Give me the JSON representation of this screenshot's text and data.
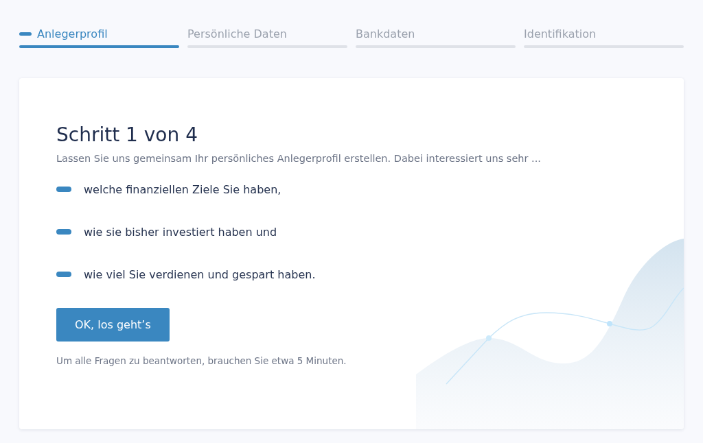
{
  "steps": [
    {
      "label": "Anlegerprofil",
      "selected": true
    },
    {
      "label": "Persönliche Daten",
      "selected": false
    },
    {
      "label": "Bankdaten",
      "selected": false
    },
    {
      "label": "Identifikation",
      "selected": false
    }
  ],
  "card": {
    "title": "Schritt 1 von 4",
    "intro": "Lassen Sie uns gemeinsam Ihr persönliches Anlegerprofil erstellen. Dabei interessiert uns sehr ...",
    "bullets": [
      "welche finanziellen Ziele Sie haben,",
      "wie sie bisher investiert haben und",
      "wie viel Sie verdienen und gespart haben."
    ],
    "button": "OK, los geht’s",
    "note": "Um alle Fragen zu beantworten, brauchen Sie etwa 5 Minuten."
  }
}
